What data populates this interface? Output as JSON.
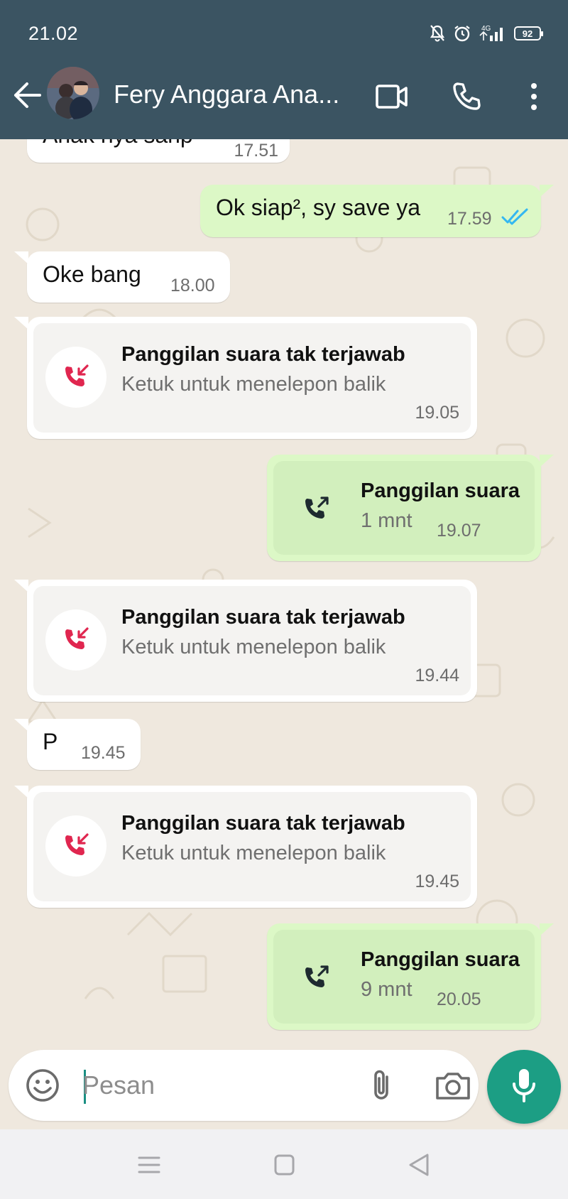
{
  "status_bar": {
    "time": "21.02",
    "network": "4G",
    "battery": "92",
    "icons": [
      "mute-bell-icon",
      "alarm-icon",
      "signal-icon",
      "battery-icon"
    ]
  },
  "header": {
    "contact_name": "Fery Anggara Ana...",
    "icons": [
      "back-arrow-icon",
      "video-call-icon",
      "voice-call-icon",
      "more-vert-icon"
    ]
  },
  "messages": [
    {
      "direction": "in",
      "text": "Anak nya sanp",
      "time": "17.51"
    },
    {
      "direction": "out",
      "text": "Ok siap², sy save ya",
      "time": "17.59",
      "status": "read"
    },
    {
      "direction": "in",
      "text": "Oke bang",
      "time": "18.00"
    },
    {
      "direction": "in",
      "type": "missed_call",
      "title": "Panggilan suara tak terjawab",
      "subtitle": "Ketuk untuk menelepon balik",
      "time": "19.05"
    },
    {
      "direction": "out",
      "type": "call",
      "title": "Panggilan suara",
      "subtitle": "1 mnt",
      "time": "19.07"
    },
    {
      "direction": "in",
      "type": "missed_call",
      "title": "Panggilan suara tak terjawab",
      "subtitle": "Ketuk untuk menelepon balik",
      "time": "19.44"
    },
    {
      "direction": "in",
      "text": "P",
      "time": "19.45"
    },
    {
      "direction": "in",
      "type": "missed_call",
      "title": "Panggilan suara tak terjawab",
      "subtitle": "Ketuk untuk menelepon balik",
      "time": "19.45"
    },
    {
      "direction": "out",
      "type": "call",
      "title": "Panggilan suara",
      "subtitle": "9 mnt",
      "time": "20.05"
    }
  ],
  "composer": {
    "placeholder": "Pesan",
    "value": ""
  },
  "colors": {
    "header": "#3b5462",
    "outgoing_bubble": "#dcf8c6",
    "incoming_bubble": "#ffffff",
    "missed_call_red": "#e0264f",
    "read_ticks": "#34b7f1",
    "mic_button": "#1c9e84",
    "chat_background": "#efe8de"
  }
}
